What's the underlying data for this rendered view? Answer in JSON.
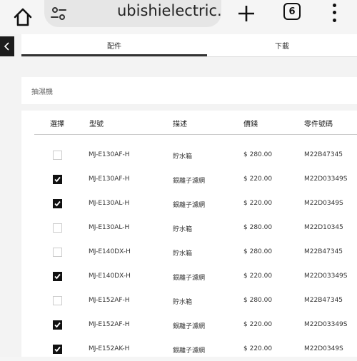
{
  "browser": {
    "url_text": "ubishielectric.com.hk",
    "tab_count": "6"
  },
  "tabs": [
    {
      "label": "配件",
      "active": true
    },
    {
      "label": "下載",
      "active": false
    }
  ],
  "category": "抽濕機",
  "table": {
    "headers": [
      "選擇",
      "型號",
      "描述",
      "價錢",
      "零件號碼"
    ],
    "rows": [
      {
        "checked": false,
        "model": "MJ-E130AF-H",
        "desc": "貯水箱",
        "price": "$ 280.00",
        "part": "M22B47345"
      },
      {
        "checked": true,
        "model": "MJ-E130AF-H",
        "desc": "銀離子濾網",
        "price": "$ 220.00",
        "part": "M22D03349S"
      },
      {
        "checked": true,
        "model": "MJ-E130AL-H",
        "desc": "銀離子濾網",
        "price": "$ 220.00",
        "part": "M22D0349S"
      },
      {
        "checked": false,
        "model": "MJ-E130AL-H",
        "desc": "貯水箱",
        "price": "$ 280.00",
        "part": "M22D10345"
      },
      {
        "checked": false,
        "model": "MJ-E140DX-H",
        "desc": "貯水箱",
        "price": "$ 280.00",
        "part": "M22B47345"
      },
      {
        "checked": true,
        "model": "MJ-E140DX-H",
        "desc": "銀離子濾網",
        "price": "$ 220.00",
        "part": "M22D03349S"
      },
      {
        "checked": false,
        "model": "MJ-E152AF-H",
        "desc": "貯水箱",
        "price": "$ 280.00",
        "part": "M22B47345"
      },
      {
        "checked": true,
        "model": "MJ-E152AF-H",
        "desc": "銀離子濾網",
        "price": "$ 220.00",
        "part": "M22D03349S"
      },
      {
        "checked": true,
        "model": "MJ-E152AK-H",
        "desc": "銀離子濾網",
        "price": "$ 220.00",
        "part": "M22D0349S"
      }
    ]
  }
}
